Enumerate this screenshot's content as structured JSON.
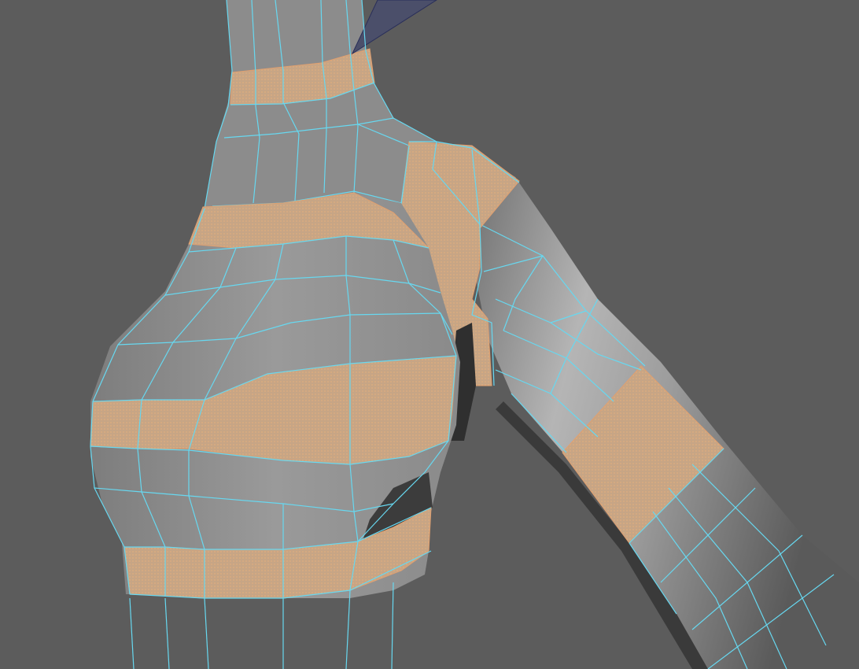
{
  "viewport": {
    "background": "#5c5c5c",
    "mesh_fill": "#8f8f8f",
    "mesh_shadow": "#4a4a4a",
    "wire_color": "#67d8f0",
    "selected_fill": "#c9a886",
    "selected_wire": "#f0a060",
    "secondary_wire": "#2a2f5a"
  },
  "selection": {
    "edge_loops_selected": 8
  }
}
